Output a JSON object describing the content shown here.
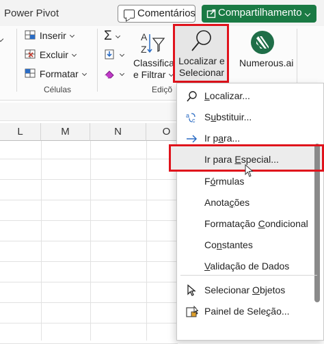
{
  "topbar": {
    "tab_label": "Power Pivot",
    "comments_label": "Comentários",
    "share_label": "Compartilhamento"
  },
  "ribbon": {
    "insert_label": "Inserir",
    "delete_label": "Excluir",
    "format_label": "Formatar",
    "cells_group": "Células",
    "sort_filter_line1": "Classificar",
    "sort_filter_line2": "e Filtrar",
    "edit_group": "Ediçõ",
    "find_select_line1": "Localizar e",
    "find_select_line2": "Selecionar",
    "numerous_label": "Numerous.ai"
  },
  "columns": [
    "L",
    "M",
    "N",
    "O"
  ],
  "menu": {
    "items": [
      {
        "pre": "",
        "u": "L",
        "post": "ocalizar..."
      },
      {
        "pre": "S",
        "u": "u",
        "post": "bstituir..."
      },
      {
        "pre": "Ir p",
        "u": "a",
        "post": "ra..."
      },
      {
        "pre": "Ir para ",
        "u": "E",
        "post": "special..."
      },
      {
        "pre": "F",
        "u": "ó",
        "post": "rmulas"
      },
      {
        "pre": "Anota",
        "u": "ç",
        "post": "ões"
      },
      {
        "pre": "Formatação ",
        "u": "C",
        "post": "ondicional"
      },
      {
        "pre": "Co",
        "u": "n",
        "post": "stantes"
      },
      {
        "pre": "",
        "u": "V",
        "post": "alidação de Dados"
      },
      {
        "pre": "Selecionar ",
        "u": "O",
        "post": "bjetos"
      },
      {
        "pre": "Painel de Sele",
        "u": "ç",
        "post": "ão..."
      }
    ]
  },
  "colors": {
    "accent_red": "#e0121b",
    "share_green": "#1a7a44",
    "numerous_green": "#1f6e48"
  }
}
